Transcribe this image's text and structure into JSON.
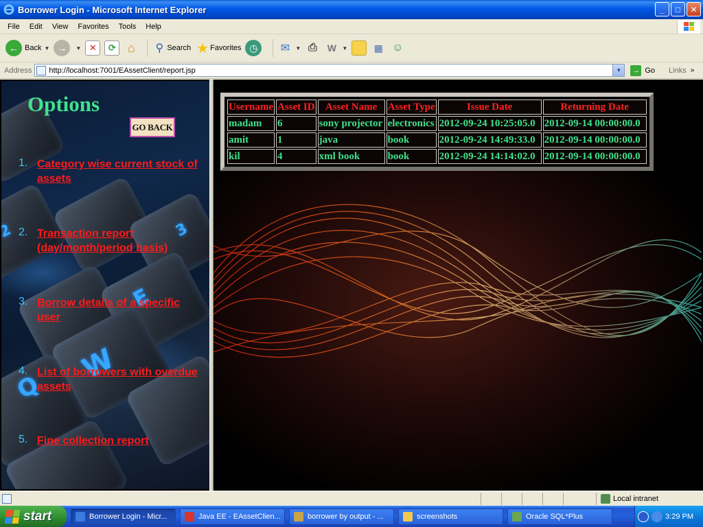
{
  "window": {
    "title": "Borrower Login - Microsoft Internet Explorer",
    "minimize": "_",
    "maximize": "□",
    "close": "✕"
  },
  "menu": [
    "File",
    "Edit",
    "View",
    "Favorites",
    "Tools",
    "Help"
  ],
  "toolbar": {
    "back": "Back",
    "search": "Search",
    "favorites": "Favorites"
  },
  "address": {
    "label": "Address",
    "url": "http://localhost:7001/EAssetClient/report.jsp",
    "go": "Go",
    "links": "Links",
    "chevron": "»"
  },
  "sidebar": {
    "title": "Options",
    "go_back": "GO BACK",
    "options": [
      {
        "num": "1.",
        "label": "Category wise current stock of assets"
      },
      {
        "num": "2.",
        "label": "Transaction report (day/month/period basis)"
      },
      {
        "num": "3.",
        "label": "Borrow details of a specific user"
      },
      {
        "num": "4.",
        "label": "List of borrowers with overdue assets"
      },
      {
        "num": "5.",
        "label": "Fine collection report"
      }
    ]
  },
  "report": {
    "headers": [
      "Username",
      "Asset ID",
      "Asset Name",
      "Asset Type",
      "Issue Date",
      "Returning Date"
    ],
    "rows": [
      [
        "madam",
        "6",
        "sony projector",
        "electronics",
        "2012-09-24 10:25:05.0",
        "2012-09-14 00:00:00.0"
      ],
      [
        "amit",
        "1",
        "java",
        "book",
        "2012-09-24 14:49:33.0",
        "2012-09-14 00:00:00.0"
      ],
      [
        "kil",
        "4",
        "xml book",
        "book",
        "2012-09-24 14:14:02.0",
        "2012-09-14 00:00:00.0"
      ]
    ]
  },
  "status": {
    "zone": "Local intranet"
  },
  "taskbar": {
    "start": "start",
    "tasks": [
      {
        "label": "Borrower Login - Micr...",
        "icon_color": "#3a7be0",
        "active": true
      },
      {
        "label": "Java EE - EAssetClien...",
        "icon_color": "#d9342b",
        "active": false
      },
      {
        "label": "borrower by output - ...",
        "icon_color": "#c9a34a",
        "active": false
      },
      {
        "label": "screenshots",
        "icon_color": "#f2c94c",
        "active": false
      },
      {
        "label": "Oracle SQL*Plus",
        "icon_color": "#6aa84f",
        "active": false
      }
    ],
    "clock": "3:29 PM"
  },
  "colors": {
    "options_title": "#3fe28c",
    "link": "#ff1a1a",
    "list_number": "#39c7ff",
    "table_header": "#ff2222",
    "table_cell": "#3fe28c"
  }
}
